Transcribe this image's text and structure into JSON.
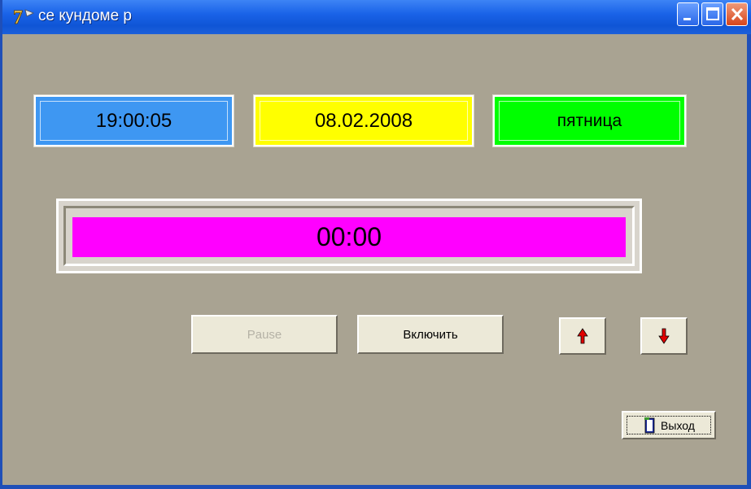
{
  "window": {
    "title": "се кундоме р",
    "icon": "app-icon-7",
    "controls": [
      "minimize-icon",
      "maximize-icon",
      "close-icon"
    ]
  },
  "info": {
    "time": "19:00:05",
    "date": "08.02.2008",
    "weekday": "пятница"
  },
  "stopwatch": {
    "display": "00:00"
  },
  "buttons": {
    "pause_label": "Pause",
    "start_label": "Включить",
    "up_icon": "arrow-up-icon",
    "down_icon": "arrow-down-icon",
    "exit_label": "Выход",
    "exit_icon": "exit-door-icon"
  },
  "colors": {
    "window_bg": "#a9a392",
    "time_bg": "#3e97f2",
    "date_bg": "#ffff00",
    "weekday_bg": "#00ff00",
    "stopwatch_bg": "#ff00ff",
    "arrow": "#e00000"
  }
}
